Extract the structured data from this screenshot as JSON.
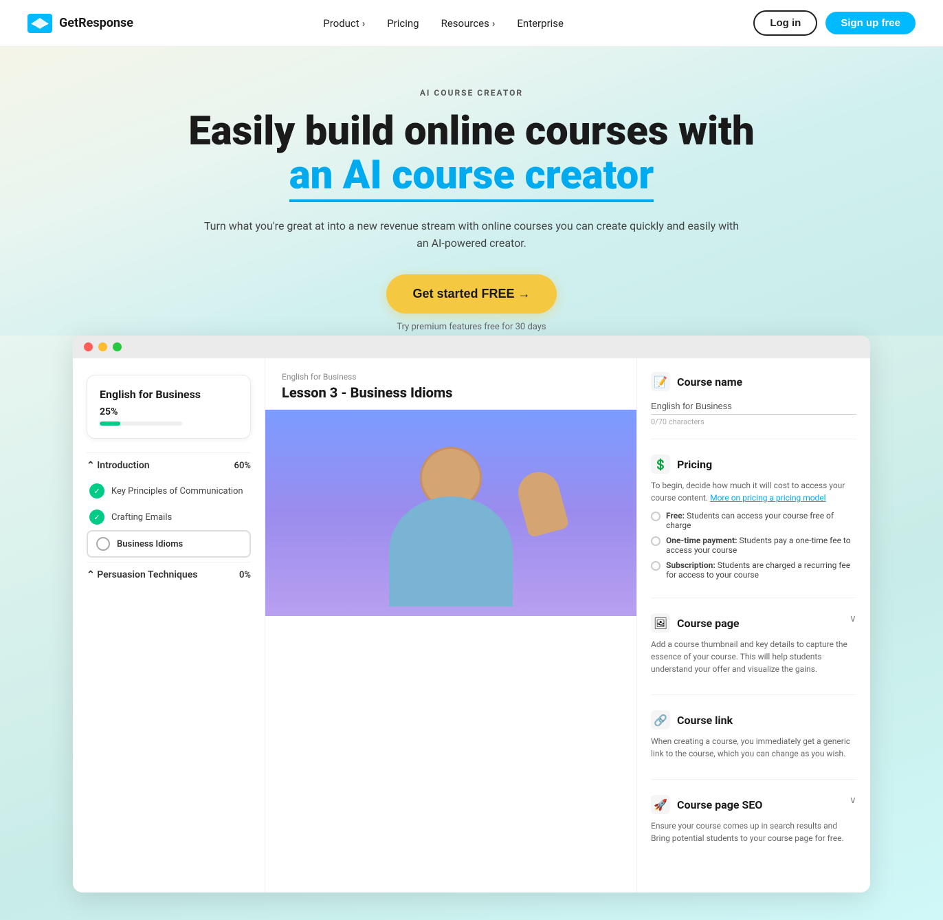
{
  "nav": {
    "logo_text": "GetResponse",
    "links": [
      {
        "label": "Product",
        "has_arrow": true
      },
      {
        "label": "Pricing",
        "has_arrow": false
      },
      {
        "label": "Resources",
        "has_arrow": true
      },
      {
        "label": "Enterprise",
        "has_arrow": false
      }
    ],
    "login_label": "Log in",
    "signup_label": "Sign up free"
  },
  "hero": {
    "eyebrow": "AI COURSE CREATOR",
    "title_line1": "Easily build online courses with",
    "title_line2": "an AI course creator",
    "subtitle": "Turn what you're great at into a new revenue stream with online courses you can create quickly and easily with an AI-powered creator.",
    "cta_label": "Get started FREE →",
    "note": "Try premium features free for 30 days"
  },
  "demo": {
    "window_dots": [
      "red",
      "yellow",
      "green"
    ],
    "left": {
      "course_title": "English for Business",
      "progress_pct": "25%",
      "progress_value": 25,
      "modules": [
        {
          "title": "Introduction",
          "pct": "60%",
          "expanded": true,
          "lessons": [
            {
              "name": "Key Principles of Communication",
              "status": "done"
            },
            {
              "name": "Crafting Emails",
              "status": "done"
            },
            {
              "name": "Business Idioms",
              "status": "active"
            }
          ]
        },
        {
          "title": "Persuasion Techniques",
          "pct": "0%",
          "expanded": false,
          "lessons": []
        }
      ]
    },
    "center": {
      "course_name": "English for Business",
      "lesson_title": "Lesson 3 - Business Idioms"
    },
    "right": {
      "sections": [
        {
          "id": "course-name",
          "title": "Course name",
          "input_value": "English for Business",
          "chars_label": "0/70 characters"
        },
        {
          "id": "pricing",
          "title": "Pricing",
          "desc_before": "To begin, decide how much it will cost to access your course content.",
          "link_text": "More on pricing a pricing model",
          "options": [
            {
              "bold": "Free:",
              "rest": " Students can access your course free of charge"
            },
            {
              "bold": "One-time payment:",
              "rest": " Students pay a one-time fee to access your course"
            },
            {
              "bold": "Subscription:",
              "rest": " Students are charged a recurring fee for access to your course"
            }
          ]
        },
        {
          "id": "course-page",
          "title": "Course page",
          "desc": "Add a course thumbnail and key details to capture the essence of your course. This will help students understand your offer and visualize the gains.",
          "collapsible": true
        },
        {
          "id": "course-link",
          "title": "Course link",
          "desc": "When creating a course, you immediately get a generic link to the course, which you can change as you wish.",
          "collapsible": false
        },
        {
          "id": "course-seo",
          "title": "Course page SEO",
          "desc": "Ensure your course comes up in search results and Bring potential students to your course page for free.",
          "collapsible": true
        }
      ]
    }
  }
}
